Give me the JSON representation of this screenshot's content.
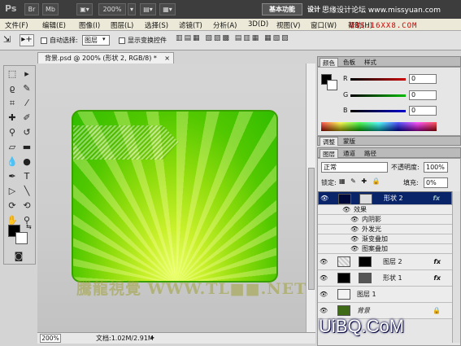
{
  "titlebar": {
    "logo": "Ps",
    "buttons": [
      "Br",
      "Mb",
      "▣▾",
      "200%",
      "▾",
      "▤▾",
      "▦▾"
    ],
    "workspace": "基本功能",
    "design": "设计",
    "watermark": "思缘设计论坛 www.missyuan.com",
    "watermark_sub": "BBS.16XX8.COM"
  },
  "menu": [
    "文件(F)",
    "编辑(E)",
    "图像(I)",
    "图层(L)",
    "选择(S)",
    "滤镜(T)",
    "分析(A)",
    "3D(D)",
    "视图(V)",
    "窗口(W)",
    "帮助(H)"
  ],
  "options": {
    "auto_select_label": "自动选择:",
    "auto_select_value": "图层",
    "show_transform": "显示变换控件"
  },
  "document": {
    "tab_title": "背景.psd @ 200% (形状 2, RGB/8) *",
    "zoom": "200%",
    "doc_info": "文档:1.02M/2.91M",
    "canvas_watermark": "騰龍視覺 WWW.TL■■.NET"
  },
  "color_panel": {
    "tabs": [
      "颜色",
      "色板",
      "样式"
    ],
    "channels": [
      {
        "label": "R",
        "value": "0",
        "color": "#cc0000"
      },
      {
        "label": "G",
        "value": "0",
        "color": "#00a000"
      },
      {
        "label": "B",
        "value": "0",
        "color": "#0000cc"
      }
    ]
  },
  "adjust_tabs": [
    "调整",
    "蒙版"
  ],
  "layers_panel": {
    "tabs": [
      "图层",
      "通道",
      "路径"
    ],
    "blend_mode": "正常",
    "opacity_label": "不透明度:",
    "opacity_value": "100%",
    "lock_label": "锁定:",
    "fill_label": "填充:",
    "fill_value": "0%",
    "layers": [
      {
        "name": "形状 2",
        "selected": true,
        "fx": true
      },
      {
        "name": "效果",
        "sub": true
      },
      {
        "name": "内阴影",
        "sub": true
      },
      {
        "name": "外发光",
        "sub": true
      },
      {
        "name": "渐变叠加",
        "sub": true
      },
      {
        "name": "图案叠加",
        "sub": true
      },
      {
        "name": "图层 2",
        "fx": true
      },
      {
        "name": "形状 1",
        "fx": true
      },
      {
        "name": "图层 1"
      },
      {
        "name": "背景",
        "italic": true
      }
    ]
  },
  "footer_logo": "UiBQ.CoM"
}
